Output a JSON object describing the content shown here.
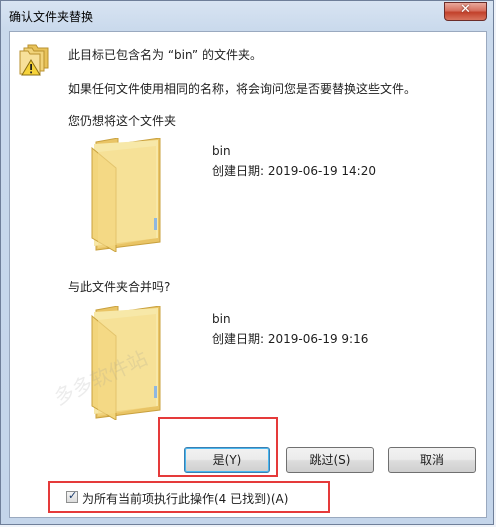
{
  "window": {
    "title": "确认文件夹替换"
  },
  "message": {
    "line1": "此目标已包含名为 “bin” 的文件夹。",
    "line2": "如果任何文件使用相同的名称，将会询问您是否要替换这些文件。",
    "line3": "您仍想将这个文件夹"
  },
  "target_folder": {
    "name": "bin",
    "created": "创建日期: 2019-06-19 14:20"
  },
  "merge_question": "与此文件夹合并吗?",
  "source_folder": {
    "name": "bin",
    "created": "创建日期: 2019-06-19 9:16"
  },
  "buttons": {
    "yes": "是(Y)",
    "skip": "跳过(S)",
    "cancel": "取消"
  },
  "apply_all": {
    "label": "为所有当前项执行此操作(4 已找到)(A)",
    "checked": true
  },
  "watermark": "多多软件站",
  "colors": {
    "highlight": "#e53a3a",
    "folder": "#f3d67a"
  },
  "icons": {
    "close": "close-icon",
    "warning": "warning-folder-icon",
    "folder": "folder-icon"
  }
}
